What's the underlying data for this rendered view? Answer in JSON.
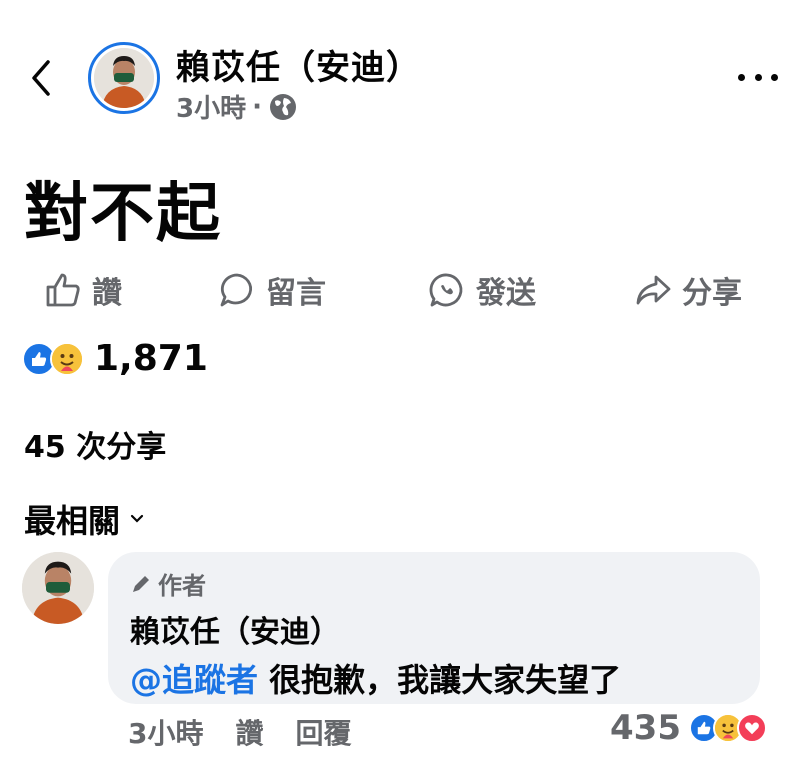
{
  "header": {
    "author": "賴苡任（安迪）",
    "time": "3小時",
    "separator": "·"
  },
  "post": {
    "text": "對不起"
  },
  "actions": [
    {
      "label": "讚",
      "icon": "thumbs-up-icon"
    },
    {
      "label": "留言",
      "icon": "comment-icon"
    },
    {
      "label": "發送",
      "icon": "messenger-icon"
    },
    {
      "label": "分享",
      "icon": "share-icon"
    }
  ],
  "reactions": {
    "count": "1,871",
    "types": [
      "like",
      "care"
    ]
  },
  "shares": "45 次分享",
  "sort": {
    "label": "最相關"
  },
  "comment": {
    "badge": "作者",
    "name": "賴苡任（安迪）",
    "mention": "@追蹤者",
    "text": " 很抱歉，我讓大家失望了",
    "time": "3小時",
    "like": "讚",
    "reply": "回覆",
    "reaction_count": "435",
    "reaction_types": [
      "like",
      "care",
      "love"
    ]
  },
  "colors": {
    "accent": "#1b74e4",
    "muted": "#65676b",
    "bubble": "#f0f2f5"
  }
}
